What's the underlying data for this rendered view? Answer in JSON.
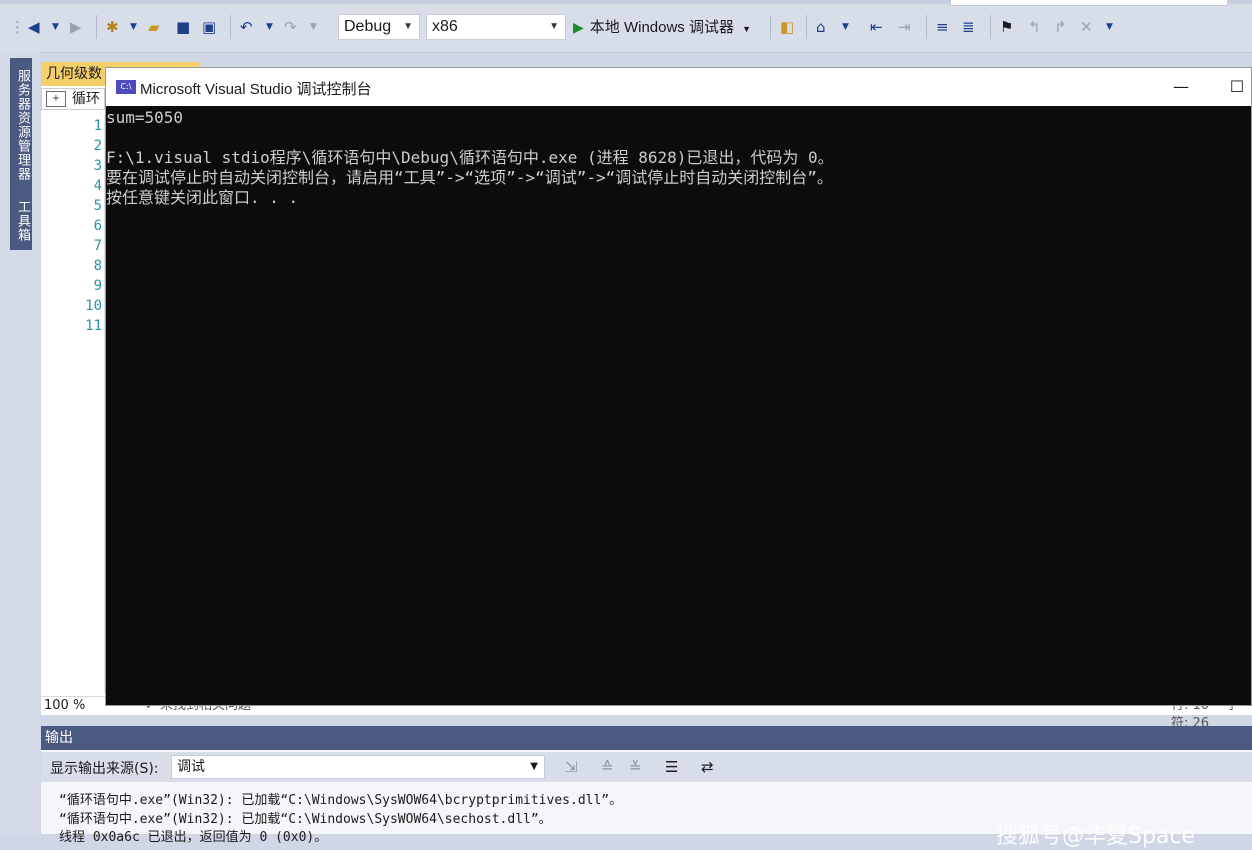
{
  "toolbar": {
    "config": "Debug",
    "platform": "x86",
    "debugger": "本地 Windows 调试器"
  },
  "left_rail": {
    "server_explorer": "服务器资源管理器",
    "toolbox": "工具箱"
  },
  "editor": {
    "tab_title": "几何级数",
    "nav_scope": "循环",
    "line_numbers": [
      "1",
      "2",
      "3",
      "4",
      "5",
      "6",
      "7",
      "8",
      "9",
      "10",
      "11"
    ],
    "zoom": "100 %",
    "issues": "未找到相关问题",
    "cursor_line": "行: 10",
    "cursor_char": "字符: 26"
  },
  "console": {
    "title": "Microsoft Visual Studio 调试控制台",
    "icon_label": "C:\\",
    "lines": [
      "sum=5050",
      "",
      "F:\\1.visual stdio程序\\循环语句中\\Debug\\循环语句中.exe (进程 8628)已退出，代码为 0。",
      "要在调试停止时自动关闭控制台，请启用“工具”->“选项”->“调试”->“调试停止时自动关闭控制台”。",
      "按任意键关闭此窗口. . ."
    ]
  },
  "output": {
    "title": "输出",
    "source_label": "显示输出来源(S):",
    "source_value": "调试",
    "lines": [
      "“循环语句中.exe”(Win32): 已加载“C:\\Windows\\SysWOW64\\bcryptprimitives.dll”。",
      "“循环语句中.exe”(Win32): 已加载“C:\\Windows\\SysWOW64\\sechost.dll”。",
      "线程 0x0a6c 已退出，返回值为 0 (0x0)。"
    ]
  },
  "watermark": "搜狐号@华夏Space"
}
